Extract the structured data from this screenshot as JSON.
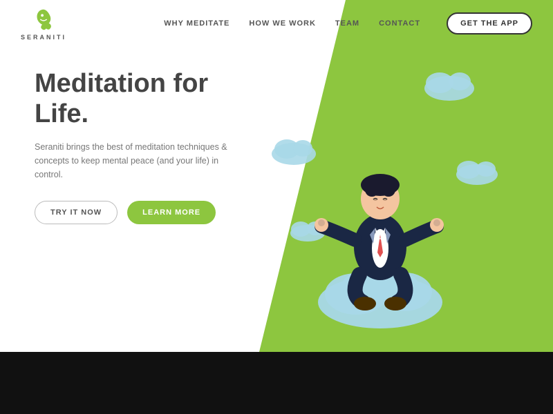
{
  "brand": {
    "name": "SERANITI",
    "logo_alt": "Seraniti logo"
  },
  "nav": {
    "links": [
      {
        "label": "WHY MEDITATE",
        "id": "why-meditate"
      },
      {
        "label": "HOW WE WORK",
        "id": "how-we-work"
      },
      {
        "label": "TEAM",
        "id": "team"
      },
      {
        "label": "CONTACT",
        "id": "contact"
      }
    ],
    "cta_label": "GET THE APP"
  },
  "hero": {
    "title": "Meditation for Life.",
    "description": "Seraniti brings the best of meditation techniques & concepts to keep mental peace (and your life) in control.",
    "btn_try": "TRY IT NOW",
    "btn_learn": "LEARN MORE"
  },
  "colors": {
    "green": "#8dc63f",
    "teal": "#a8d8e8",
    "dark": "#111111"
  }
}
